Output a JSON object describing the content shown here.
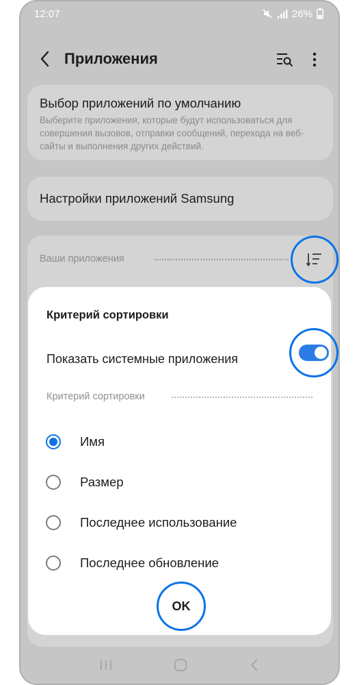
{
  "status_bar": {
    "time": "12:07",
    "battery": "26%",
    "icons": [
      "mute-icon",
      "signal-icon",
      "battery-icon"
    ]
  },
  "header": {
    "title": "Приложения",
    "back_icon": "chevron-left-icon",
    "search_icon": "list-search-icon",
    "more_icon": "more-vertical-icon"
  },
  "default_apps": {
    "title": "Выбор приложений по умолчанию",
    "description": "Выберите приложения, которые будут использоваться для совершения вызовов, отправки сообщений, перехода на веб-сайты и выполнения других действий."
  },
  "samsung_settings": {
    "title": "Настройки приложений Samsung"
  },
  "your_apps": {
    "label": "Ваши приложения",
    "sort_icon": "sort-icon"
  },
  "dialog": {
    "title": "Критерий сортировки",
    "toggle_label": "Показать системные приложения",
    "toggle_on": true,
    "sort_subheader": "Критерий сортировки",
    "options": [
      {
        "label": "Имя",
        "checked": true
      },
      {
        "label": "Размер",
        "checked": false
      },
      {
        "label": "Последнее использование",
        "checked": false
      },
      {
        "label": "Последнее обновление",
        "checked": false
      }
    ],
    "ok_label": "OK"
  },
  "nav_bar": {
    "icons": [
      "recent-apps-icon",
      "home-icon",
      "back-icon"
    ]
  },
  "colors": {
    "accent": "#0a73e8",
    "toggle": "#2c7ce6",
    "dim_background": "#c6c6c6"
  }
}
